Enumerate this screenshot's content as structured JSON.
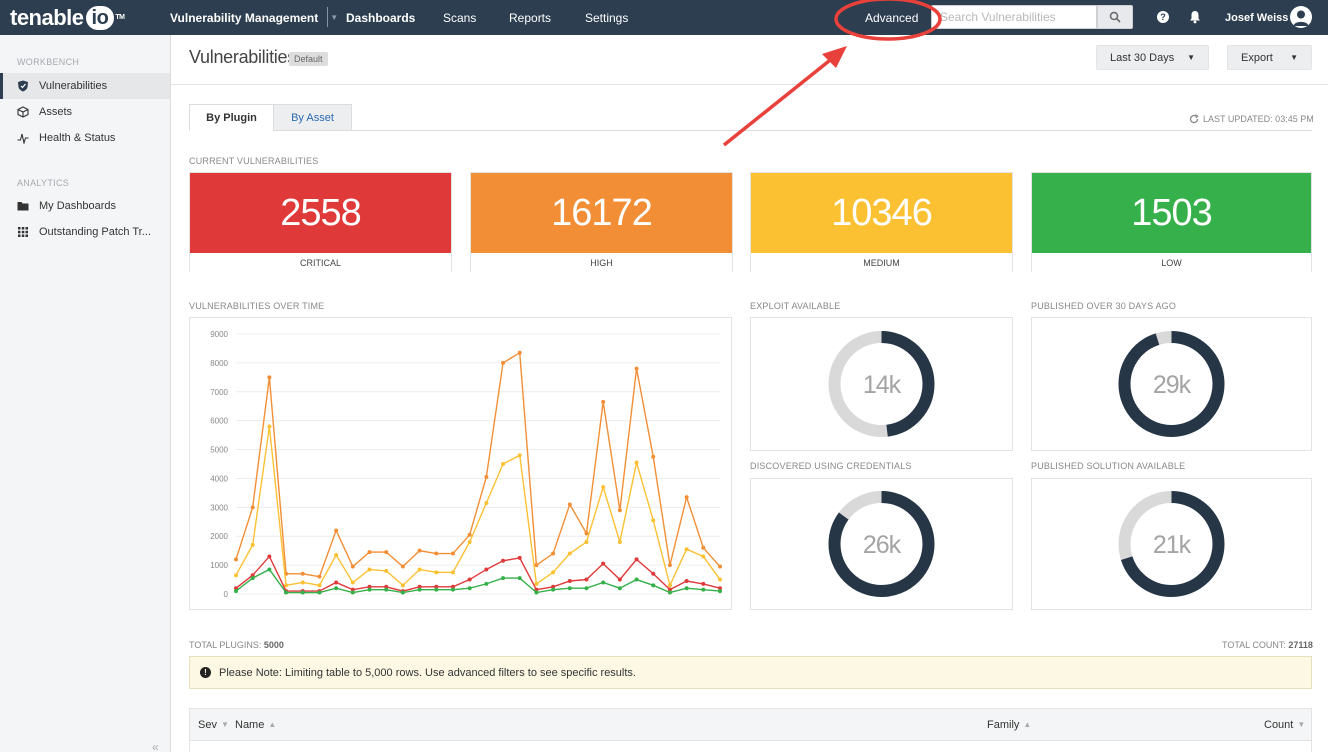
{
  "header": {
    "logo_text": "tenable",
    "logo_io": "io",
    "logo_tm": "TM",
    "product": "Vulnerability Management",
    "nav": [
      "Dashboards",
      "Scans",
      "Reports",
      "Settings"
    ],
    "advanced_label": "Advanced",
    "search_placeholder": "Search Vulnerabilities",
    "user_name": "Josef Weiss",
    "help_glyph": "?"
  },
  "sidebar": {
    "workbench_label": "WORKBENCH",
    "workbench_items": [
      "Vulnerabilities",
      "Assets",
      "Health & Status"
    ],
    "analytics_label": "ANALYTICS",
    "analytics_items": [
      "My Dashboards",
      "Outstanding Patch Tr..."
    ],
    "collapse_glyph": "«"
  },
  "page": {
    "title": "Vulnerabilities",
    "badge": "Default",
    "date_range": "Last 30 Days",
    "export_label": "Export",
    "tabs": [
      "By Plugin",
      "By Asset"
    ],
    "last_updated": "LAST UPDATED: 03:45 PM"
  },
  "current_vulns": {
    "label": "CURRENT VULNERABILITIES",
    "cards": [
      {
        "value": "2558",
        "label": "CRITICAL",
        "color": "#e0393a"
      },
      {
        "value": "16172",
        "label": "HIGH",
        "color": "#f28f36"
      },
      {
        "value": "10346",
        "label": "MEDIUM",
        "color": "#fcc133"
      },
      {
        "value": "1503",
        "label": "LOW",
        "color": "#35b04a"
      }
    ]
  },
  "vulns_over_time_label": "VULNERABILITIES OVER TIME",
  "donuts": [
    {
      "label": "EXPLOIT AVAILABLE",
      "value": "14k",
      "fraction": 0.48
    },
    {
      "label": "PUBLISHED OVER 30 DAYS AGO",
      "value": "29k",
      "fraction": 0.95
    },
    {
      "label": "DISCOVERED USING CREDENTIALS",
      "value": "26k",
      "fraction": 0.85
    },
    {
      "label": "PUBLISHED SOLUTION AVAILABLE",
      "value": "21k",
      "fraction": 0.7
    }
  ],
  "chart_data": {
    "type": "line",
    "ylim": [
      0,
      9000
    ],
    "yticks": [
      "0",
      "1000",
      "2000",
      "3000",
      "4000",
      "5000",
      "6000",
      "7000",
      "8000",
      "9000"
    ],
    "series": [
      {
        "color": "#f28f36",
        "values": [
          1200,
          3000,
          7500,
          700,
          700,
          600,
          2200,
          950,
          1450,
          1450,
          950,
          1500,
          1400,
          1400,
          2050,
          4050,
          8000,
          8350,
          1000,
          1400,
          3100,
          2100,
          6650,
          2900,
          7800,
          4750,
          1000,
          3350,
          1600,
          950
        ]
      },
      {
        "color": "#fcc133",
        "values": [
          650,
          1700,
          5800,
          300,
          400,
          300,
          1350,
          400,
          850,
          800,
          300,
          850,
          750,
          750,
          1800,
          3150,
          4500,
          4800,
          350,
          750,
          1400,
          1800,
          3700,
          1800,
          4550,
          2550,
          300,
          1550,
          1300,
          500
        ]
      },
      {
        "color": "#e0393a",
        "values": [
          200,
          650,
          1300,
          100,
          100,
          100,
          400,
          150,
          250,
          250,
          100,
          250,
          250,
          250,
          500,
          850,
          1150,
          1250,
          150,
          250,
          450,
          500,
          1050,
          500,
          1200,
          700,
          150,
          450,
          350,
          200
        ]
      },
      {
        "color": "#35b04a",
        "values": [
          100,
          550,
          850,
          50,
          50,
          50,
          200,
          50,
          150,
          150,
          50,
          150,
          150,
          150,
          200,
          350,
          550,
          550,
          50,
          150,
          200,
          200,
          400,
          200,
          500,
          300,
          50,
          200,
          150,
          100
        ]
      }
    ]
  },
  "table": {
    "total_plugins_label": "TOTAL PLUGINS:",
    "total_plugins": "5000",
    "total_count_label": "TOTAL COUNT:",
    "total_count": "27118",
    "note": "Please Note: Limiting table to 5,000 rows. Use advanced filters to see specific results.",
    "note_glyph": "!",
    "columns": [
      "Sev",
      "Name",
      "Family",
      "Count"
    ]
  },
  "annotation_color": "#e8403a"
}
